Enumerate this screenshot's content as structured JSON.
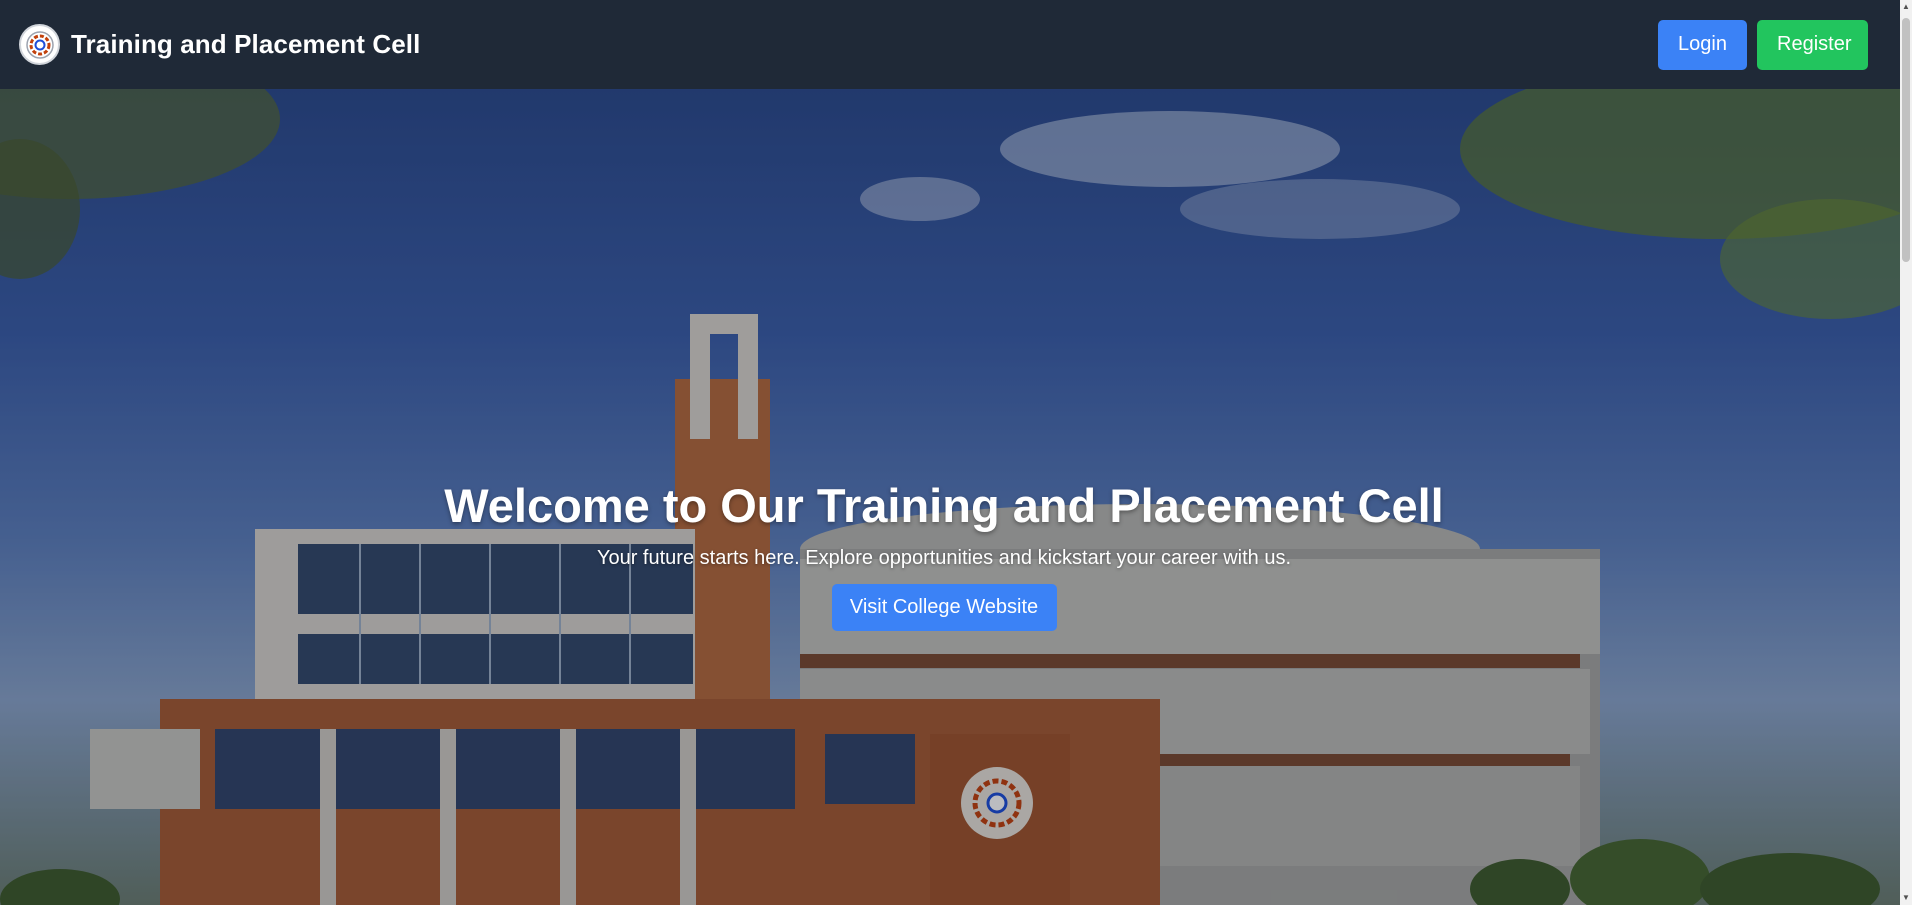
{
  "header": {
    "title": "Training and Placement Cell",
    "logo_icon": "college-emblem-icon",
    "login_label": "Login",
    "register_label": "Register"
  },
  "hero": {
    "title": "Welcome to Our Training and Placement Cell",
    "subtitle": "Your future starts here. Explore opportunities and kickstart your career with us.",
    "cta_label": "Visit College Website"
  },
  "colors": {
    "navbar": "#1f2937",
    "login": "#3b82f6",
    "register": "#22c55e",
    "cta": "#3b82f6"
  }
}
